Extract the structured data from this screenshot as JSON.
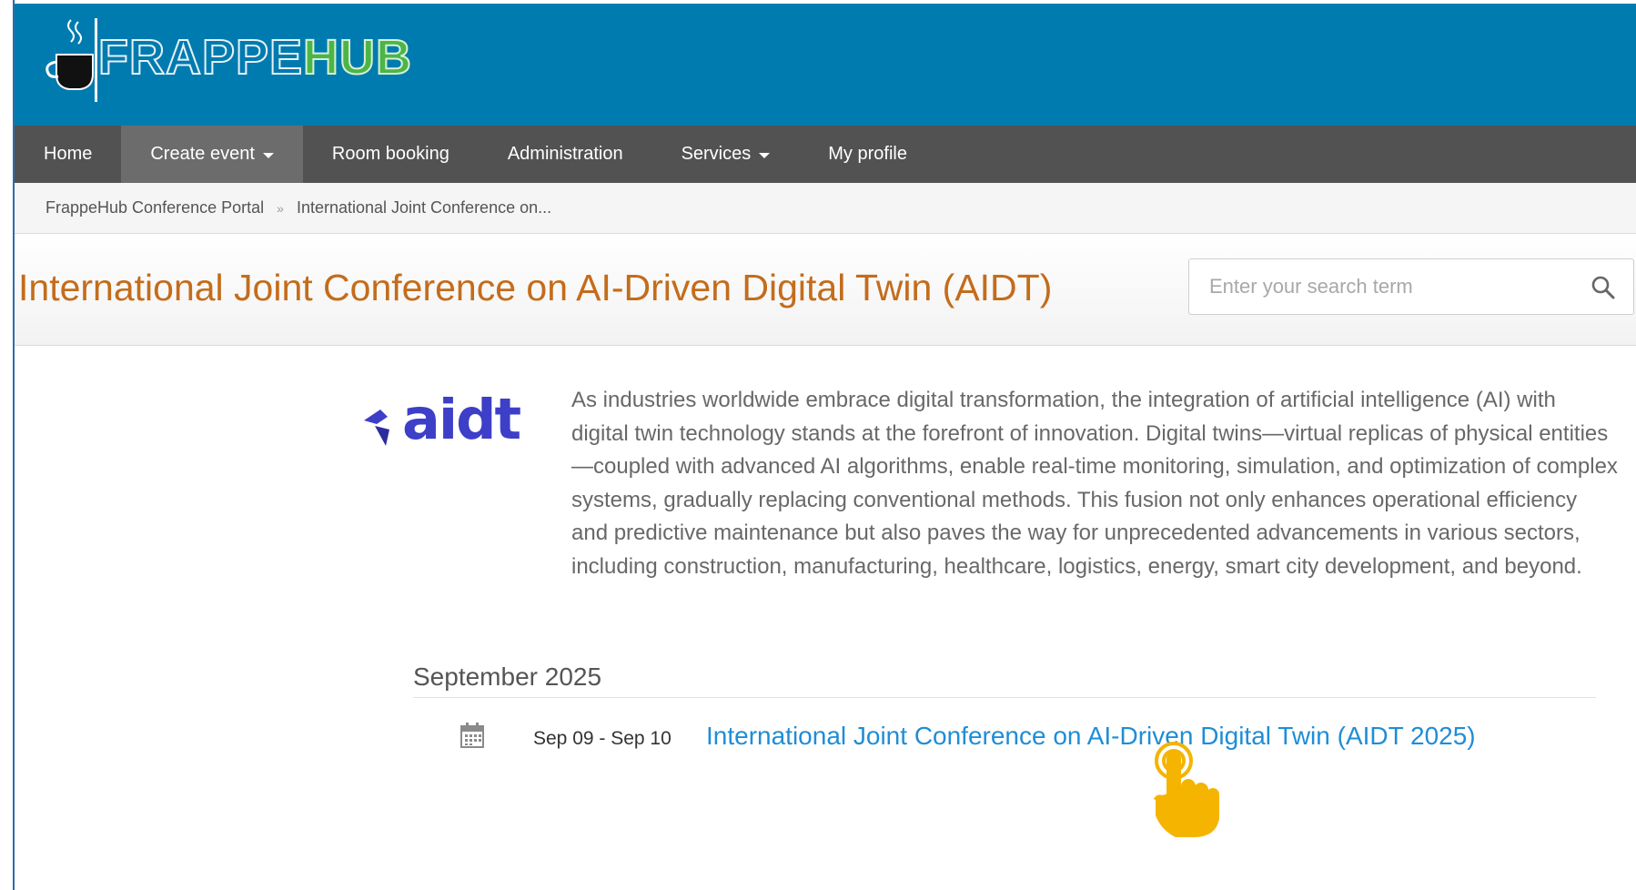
{
  "header": {
    "logo": {
      "part1": "FRAPPE",
      "part2": "HUB"
    }
  },
  "nav": {
    "items": [
      {
        "label": "Home",
        "dropdown": false,
        "active": false
      },
      {
        "label": "Create event",
        "dropdown": true,
        "active": true
      },
      {
        "label": "Room booking",
        "dropdown": false,
        "active": false
      },
      {
        "label": "Administration",
        "dropdown": false,
        "active": false
      },
      {
        "label": "Services",
        "dropdown": true,
        "active": false
      },
      {
        "label": "My profile",
        "dropdown": false,
        "active": false
      }
    ]
  },
  "breadcrumb": {
    "items": [
      "FrappeHub Conference Portal",
      "International Joint Conference on..."
    ],
    "separator": "»"
  },
  "page": {
    "title": "International Joint Conference on AI-Driven Digital Twin (AIDT)"
  },
  "search": {
    "placeholder": "Enter your search term",
    "value": "",
    "icon": "search-icon"
  },
  "event_logo": {
    "text": "aidt"
  },
  "description": "As industries worldwide embrace digital transformation, the integration of artificial intelligence (AI) with digital twin technology stands at the forefront of innovation. Digital twins—virtual replicas of physical entities—coupled with advanced AI algorithms, enable real-time monitoring, simulation, and optimization of complex systems, gradually replacing conventional methods. This fusion not only enhances operational efficiency and predictive maintenance but also paves the way for unprecedented advancements in various sectors, including construction, manufacturing, healthcare, logistics, energy, smart city development, and beyond.",
  "events": {
    "month": "September 2025",
    "items": [
      {
        "dates": "Sep 09 - Sep 10",
        "title": "International Joint Conference on AI-Driven Digital Twin (AIDT 2025)",
        "icon": "calendar-icon"
      }
    ]
  },
  "colors": {
    "header_bg": "#007bb0",
    "nav_bg": "#525252",
    "nav_active_bg": "#6c6c6c",
    "title": "#c46c1b",
    "link": "#1f8dd6",
    "logo_hub": "#4cb548",
    "event_logo": "#3d3fc8",
    "pointer": "#f5b400"
  }
}
